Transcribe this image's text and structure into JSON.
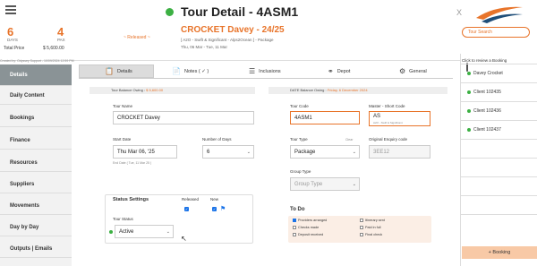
{
  "header": {
    "title": "Tour Detail - 4ASM1",
    "close": "X"
  },
  "summary": {
    "days_value": "6",
    "days_label": "DAYS",
    "pax_value": "4",
    "pax_label": "PAX",
    "total_price_label": "Total Price",
    "total_price_value": "$ 5,600.00",
    "status": "~ Released ~",
    "tour_name": "CROCKET Davey - 24/25",
    "tour_sub": "[ A2O - Swift & Significant - Alps2Ocean ] - Package",
    "tour_dates": "Thu, 06 Mar - Tue, 11 Mar",
    "created_by": "Created by: Odyssey Support - 10/09/2024 12:59 PM",
    "search_label": "Tour Search"
  },
  "sidebar": {
    "items": [
      {
        "label": "Details",
        "active": true
      },
      {
        "label": "Daily Content"
      },
      {
        "label": "Bookings"
      },
      {
        "label": "Finance"
      },
      {
        "label": "Resources"
      },
      {
        "label": "Suppliers"
      },
      {
        "label": "Movements"
      },
      {
        "label": "Day by Day"
      },
      {
        "label": "Outputs | Emails"
      }
    ]
  },
  "tabs": [
    {
      "label": "Details",
      "icon": "clipboard-icon",
      "active": true
    },
    {
      "label": "Notes ( ✓ )",
      "icon": "document-icon"
    },
    {
      "label": "Inclusions",
      "icon": "list-icon"
    },
    {
      "label": "Depot",
      "icon": "tag-icon"
    },
    {
      "label": "General",
      "icon": "gear-icon"
    }
  ],
  "balances": {
    "tour_label": "Tour Balance Owing :",
    "tour_value": "$ 5,600.00",
    "date_label": "DATE Balance Owing :",
    "date_value": "Friday, 6 December 2024"
  },
  "form": {
    "tour_name_label": "Tour Name",
    "tour_name_value": "CROCKET Davey",
    "tour_code_label": "Tour Code",
    "tour_code_value": "4ASM1",
    "master_code_label": "Master - Short Code",
    "master_code_value": "AS",
    "master_code_sub": "A2O - Swift & Significant",
    "start_date_label": "Start Date",
    "start_date_value": "Thu Mar 06, '25",
    "end_date_text": "End Date ( Tue, 11 Mar 25 )",
    "num_days_label": "Number of Days",
    "num_days_value": "6",
    "tour_type_label": "Tour Type",
    "tour_type_clear": "Clear",
    "tour_type_value": "Package",
    "orig_enquiry_label": "Original Enquiry code",
    "orig_enquiry_value": "3EE12",
    "group_type_label": "Group Type",
    "group_type_placeholder": "Group Type"
  },
  "status_settings": {
    "title": "Status Settings",
    "released_label": "Released",
    "new_label": "New",
    "released_checked": true,
    "new_checked": true,
    "tour_status_label": "Tour Status",
    "tour_status_value": "Active"
  },
  "todo": {
    "title": "To Do",
    "items": [
      {
        "label": "Providers arranged",
        "checked": true
      },
      {
        "label": "Itinerary sent",
        "checked": false
      },
      {
        "label": "Checks made",
        "checked": false
      },
      {
        "label": "Paid in full",
        "checked": false
      },
      {
        "label": "Deposit received",
        "checked": false
      },
      {
        "label": "Final check",
        "checked": false
      }
    ]
  },
  "right_panel": {
    "hint": "Click to review a Booking",
    "clients": [
      "Davey Crocket",
      "Client 102435",
      "Client 102436",
      "Client 102437"
    ],
    "booking_button": "Booking",
    "plus": "+"
  },
  "colors": {
    "accent": "#e8742a",
    "status_green": "#3cb043",
    "sidebar_active": "#8a9396",
    "checkbox_blue": "#1a73e8"
  }
}
